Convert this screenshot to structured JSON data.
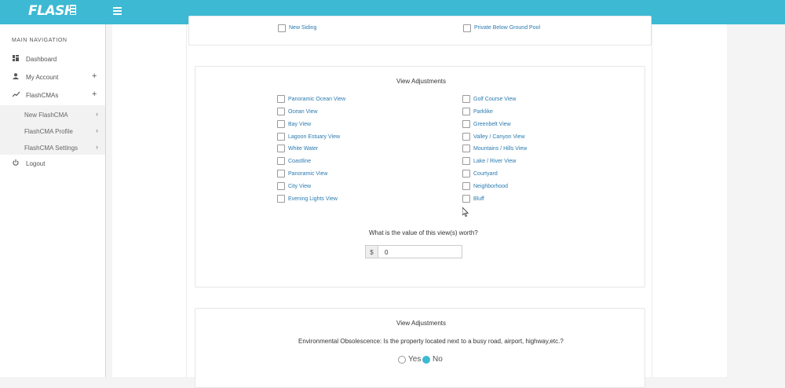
{
  "app": {
    "logo_text": "FLASH"
  },
  "sidebar": {
    "header": "MAIN NAVIGATION",
    "items": [
      {
        "label": "Dashboard",
        "icon": "dashboard-icon"
      },
      {
        "label": "My Account",
        "icon": "user-icon",
        "expand": "+"
      },
      {
        "label": "FlashCMAs",
        "icon": "chart-line-icon",
        "expand": "+"
      }
    ],
    "subitems": [
      {
        "label": "New FlashCMA"
      },
      {
        "label": "FlashCMA Profile"
      },
      {
        "label": "FlashCMA Settings"
      }
    ],
    "logout": {
      "label": "Logout",
      "icon": "power-icon"
    }
  },
  "top_panel": {
    "left_option": "New Siding",
    "right_option": "Private Below Ground Pool"
  },
  "view_panel": {
    "title": "View Adjustments",
    "left_options": [
      "Panoramic Ocean View",
      "Ocean View",
      "Bay View",
      "Lagoon Estuary View",
      "White Water",
      "Coastline",
      "Panoramic View",
      "City View",
      "Evening Lights View"
    ],
    "right_options": [
      "Golf Course View",
      "Parklike",
      "Greenbelt View",
      "Valley / Canyon View",
      "Mountains / Hills View",
      "Lake / River View",
      "Courtyard",
      "Neighborhood",
      "Bluff"
    ],
    "question": "What is the value of this view(s) worth?",
    "currency": "$",
    "value": "0"
  },
  "env_panel": {
    "title": "View Adjustments",
    "question": "Environmental Obsolescence: Is the property located next to a busy road, airport, highway,etc.?",
    "yes_label": "Yes",
    "no_label": "No",
    "selected": "No"
  },
  "colors": {
    "header": "#3db9d3",
    "link": "#2a7ab0"
  }
}
